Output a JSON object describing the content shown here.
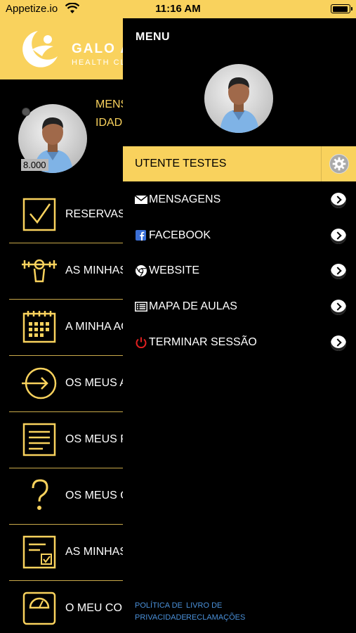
{
  "status_bar": {
    "carrier": "Appetize.io",
    "time": "11:16 AM"
  },
  "main": {
    "logo_name": "GALO A",
    "logo_sub": "HEALTH CL",
    "message_line1": "MENS",
    "message_line2": "IDADE",
    "points": "8.000",
    "items": [
      {
        "label": "RESERVAS",
        "icon": "checkbox-icon"
      },
      {
        "label": "AS MINHAS AU",
        "icon": "cyclist-icon"
      },
      {
        "label": "A MINHA AGEI",
        "icon": "calendar-icon"
      },
      {
        "label": "OS MEUS ACE",
        "icon": "entry-arrow-icon"
      },
      {
        "label": "OS MEUS PLA",
        "icon": "document-icon"
      },
      {
        "label": "OS MEUS QUE",
        "icon": "question-icon"
      },
      {
        "label": "AS MINHAS AV",
        "icon": "evaluation-icon"
      },
      {
        "label": "O MEU CONTR",
        "icon": "scale-icon"
      }
    ]
  },
  "drawer": {
    "title": "MENU",
    "user_name": "UTENTE TESTES",
    "items": [
      {
        "label": "MENSAGENS",
        "icon": "envelope-icon"
      },
      {
        "label": "FACEBOOK",
        "icon": "facebook-icon"
      },
      {
        "label": "WEBSITE",
        "icon": "chrome-icon"
      },
      {
        "label": "MAPA DE AULAS",
        "icon": "list-icon"
      },
      {
        "label": "TERMINAR SESSÃO",
        "icon": "power-icon"
      }
    ],
    "footer": {
      "privacy_line1": "POLÍTICA DE",
      "privacy_line2": "PRIVACIDADE",
      "complaints_line1": "LIVRO DE",
      "complaints_line2": "RECLAMAÇÕES"
    }
  },
  "colors": {
    "accent": "#f9d25d",
    "divider": "#c9a94a",
    "link": "#4a90d9",
    "power": "#e02020",
    "facebook": "#3b6fd6"
  }
}
